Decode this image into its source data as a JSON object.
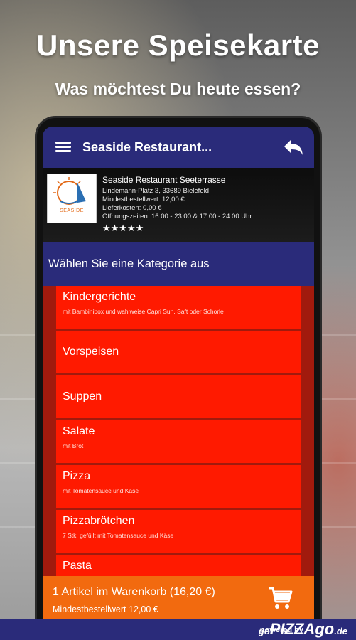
{
  "promo": {
    "headline": "Unsere Speisekarte",
    "subline": "Was möchtest Du heute essen?"
  },
  "appbar": {
    "title": "Seaside Restaurant...",
    "menu_icon": "hamburger-menu-icon",
    "back_icon": "back-arrow-icon"
  },
  "restaurant": {
    "logo_text": "SEASIDE",
    "name": "Seaside Restaurant Seeterrasse",
    "address": "Lindemann-Platz 3, 33689 Bielefeld",
    "min_order": "Mindestbestellwert: 12,00 €",
    "delivery_cost": "Lieferkosten: 0,00 €",
    "hours": "Öffnungszeiten: 16:00 - 23:00 & 17:00 - 24:00 Uhr",
    "stars": "★★★★★",
    "rating": 5
  },
  "category_header": "Wählen Sie eine Kategorie aus",
  "categories": [
    {
      "name": "Kindergerichte",
      "desc": "mit Bambinibox und wahlweise Capri Sun, Saft oder Schorle"
    },
    {
      "name": "Vorspeisen",
      "desc": ""
    },
    {
      "name": "Suppen",
      "desc": ""
    },
    {
      "name": "Salate",
      "desc": "mit Brot"
    },
    {
      "name": "Pizza",
      "desc": "mit Tomatensauce und Käse"
    },
    {
      "name": "Pizzabrötchen",
      "desc": "7 Stk. gefüllt mit Tomatensauce und Käse"
    },
    {
      "name": "Pasta",
      "desc": ""
    }
  ],
  "cart": {
    "line1": "1 Artikel im Warenkorb (16,20 €)",
    "line2": "Mindestbestellwert 12,00 €",
    "icon": "shopping-cart-icon"
  },
  "footer": {
    "powered_by": "powered by",
    "brand_go": "go",
    "brand_main": "PIZZAgo",
    "brand_suffix": ".de"
  },
  "colors": {
    "primary": "#2a2b7a",
    "category": "#ff1a00",
    "cart": "#f26a0f"
  }
}
